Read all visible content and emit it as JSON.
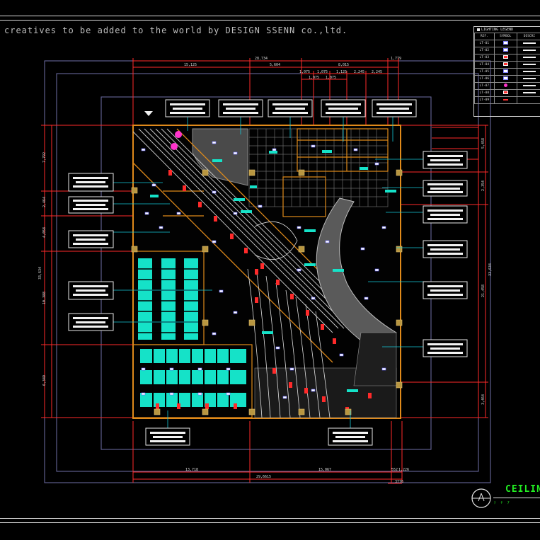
{
  "banner": "creatives to be added to the world by  DESIGN SSENN co.,ltd.",
  "legend": {
    "title": "LIGHTING LEGEND",
    "headers": [
      "REF.",
      "SYMBOL",
      "DESCRI"
    ],
    "rows": [
      "LT-01",
      "LT-02",
      "LT-03",
      "LT-04",
      "LT-05",
      "LT-06",
      "LT-07",
      "LT-08",
      "LT-09"
    ]
  },
  "dimensions": {
    "top_total": "28,734",
    "top_a": "15,125",
    "top_b": "5,604",
    "top_c": "8,015",
    "top_d": "1,779",
    "top_e1": "1,075",
    "top_e2": "1,075",
    "top_e3": "1,125",
    "top_e4": "2,245",
    "top_e5": "2,245",
    "top_f1": "1,075",
    "top_f2": "1,075",
    "left_a": "7,792",
    "left_b": "2,464",
    "left_c": "4,058",
    "left_total": "33,634",
    "left_d": "10,388",
    "left_e": "6,349",
    "right_a": "5,458",
    "right_b": "2,354",
    "right_total": "33,634",
    "right_c": "21,458",
    "right_d": "3,464",
    "bottom_a": "13,718",
    "bottom_b": "15,067",
    "bottom_c": "552",
    "bottom_d": "1,226",
    "bottom_total": "29,6615",
    "bottom_e": "3776"
  },
  "title": {
    "main": "CEILING",
    "sub": "ﾃ ﾔ ｱ"
  },
  "colors": {
    "wall_orange": "#e08a1a",
    "dim_red": "#ff2a2a",
    "cyan_fixture": "#15e2c8",
    "grid_gray": "#6a6a6a",
    "label_white": "#f2f2f2",
    "title_green": "#22ee22"
  }
}
